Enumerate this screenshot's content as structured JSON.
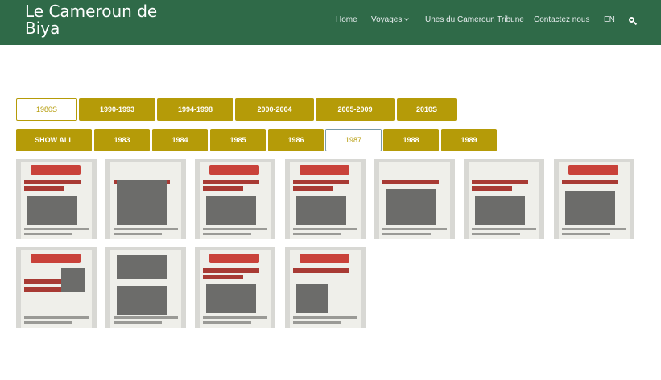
{
  "header": {
    "site_title": "Le Cameroun de Biya",
    "nav": [
      {
        "label": "Home",
        "dropdown": false
      },
      {
        "label": "Voyages",
        "dropdown": true
      },
      {
        "label": "Unes du Cameroun Tribune",
        "dropdown": false
      },
      {
        "label": "Contactez nous",
        "dropdown": false
      },
      {
        "label": "EN",
        "dropdown": false
      }
    ],
    "search_icon": "search-icon",
    "bg_color": "#2f6a48"
  },
  "decade_filters": [
    {
      "label": "1980S",
      "active": true
    },
    {
      "label": "1990-1993",
      "active": false
    },
    {
      "label": "1994-1998",
      "active": false
    },
    {
      "label": "2000-2004",
      "active": false
    },
    {
      "label": "2005-2009",
      "active": false
    },
    {
      "label": "2010S",
      "active": false
    }
  ],
  "year_filters": [
    {
      "label": "SHOW ALL",
      "active": false
    },
    {
      "label": "1983",
      "active": false
    },
    {
      "label": "1984",
      "active": false
    },
    {
      "label": "1985",
      "active": false
    },
    {
      "label": "1986",
      "active": false
    },
    {
      "label": "1987",
      "active": true
    },
    {
      "label": "1988",
      "active": false
    },
    {
      "label": "1989",
      "active": false
    }
  ],
  "accent_color": "#b59b08",
  "gallery_count": 11
}
